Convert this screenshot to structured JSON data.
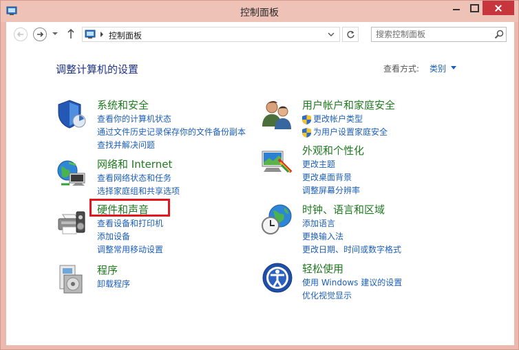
{
  "window": {
    "title": "控制面板"
  },
  "address_bar": {
    "location": "控制面板"
  },
  "search": {
    "placeholder": "搜索控制面板"
  },
  "main": {
    "heading": "调整计算机的设置",
    "view_by_label": "查看方式:",
    "view_by_value": "类别"
  },
  "categories_left": [
    {
      "title": "系统和安全",
      "icon": "shield-icon",
      "links": [
        "查看你的计算机状态",
        "通过文件历史记录保存你的文件备份副本",
        "查找并解决问题"
      ]
    },
    {
      "title": "网络和 Internet",
      "icon": "network-globe-icon",
      "links": [
        "查看网络状态和任务",
        "选择家庭组和共享选项"
      ]
    },
    {
      "title": "硬件和声音",
      "icon": "printer-icon",
      "links": [
        "查看设备和打印机",
        "添加设备",
        "调整常用移动设置"
      ]
    },
    {
      "title": "程序",
      "icon": "programs-icon",
      "links": [
        "卸载程序"
      ]
    }
  ],
  "categories_right": [
    {
      "title": "用户帐户和家庭安全",
      "icon": "users-icon",
      "links": [
        "更改帐户类型",
        "为用户设置家庭安全"
      ]
    },
    {
      "title": "外观和个性化",
      "icon": "appearance-icon",
      "links": [
        "更改主题",
        "更改桌面背景",
        "调整屏幕分辨率"
      ]
    },
    {
      "title": "时钟、语言和区域",
      "icon": "clock-globe-icon",
      "links": [
        "添加语言",
        "更换输入法",
        "更改日期、时间或数字格式"
      ]
    },
    {
      "title": "轻松使用",
      "icon": "ease-of-access-icon",
      "links": [
        "使用 Windows 建议的设置",
        "优化视觉显示"
      ]
    }
  ],
  "colors": {
    "title_bar": "#efc2b8",
    "close_button": "#c7363c",
    "heading": "#1e3287",
    "category_title": "#1f7a1f",
    "link": "#1c5fb8",
    "highlight": "#e6141b"
  }
}
